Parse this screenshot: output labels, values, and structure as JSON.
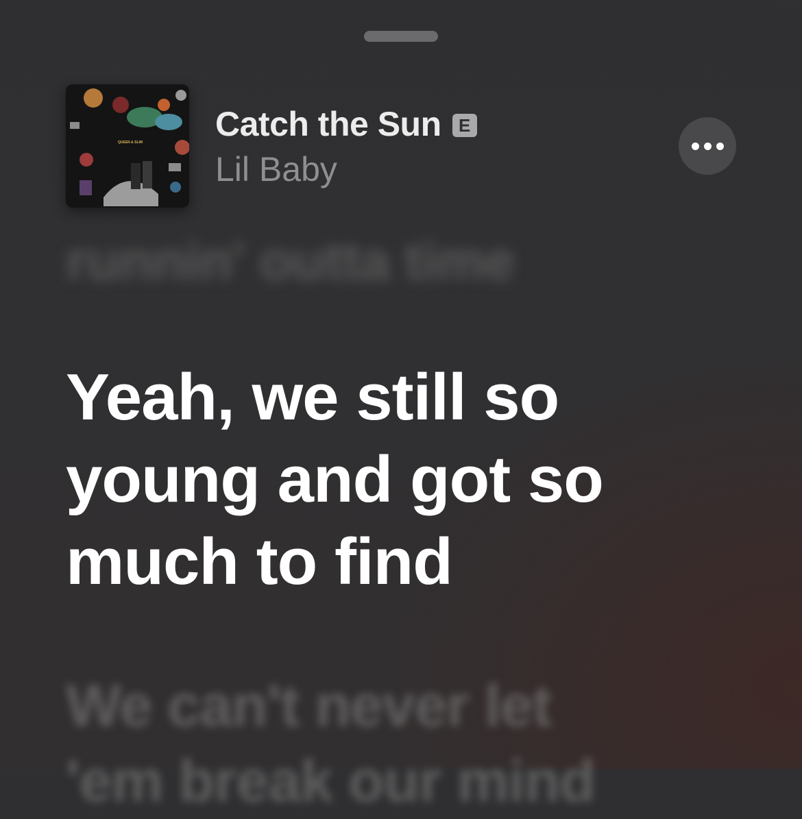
{
  "now_playing": {
    "title": "Catch the Sun",
    "explicit_badge": "E",
    "artist": "Lil Baby",
    "artwork_text": "QUEEN & SLIM"
  },
  "lyrics": {
    "previous_line": "runnin' outta time",
    "current_line": [
      "Yeah, we still so",
      "young and got so",
      "much to find"
    ],
    "next_line": [
      "We can't never let",
      "'em break our mind"
    ]
  },
  "icons": {
    "more": "ellipsis-icon",
    "grabber": "sheet-grabber"
  }
}
